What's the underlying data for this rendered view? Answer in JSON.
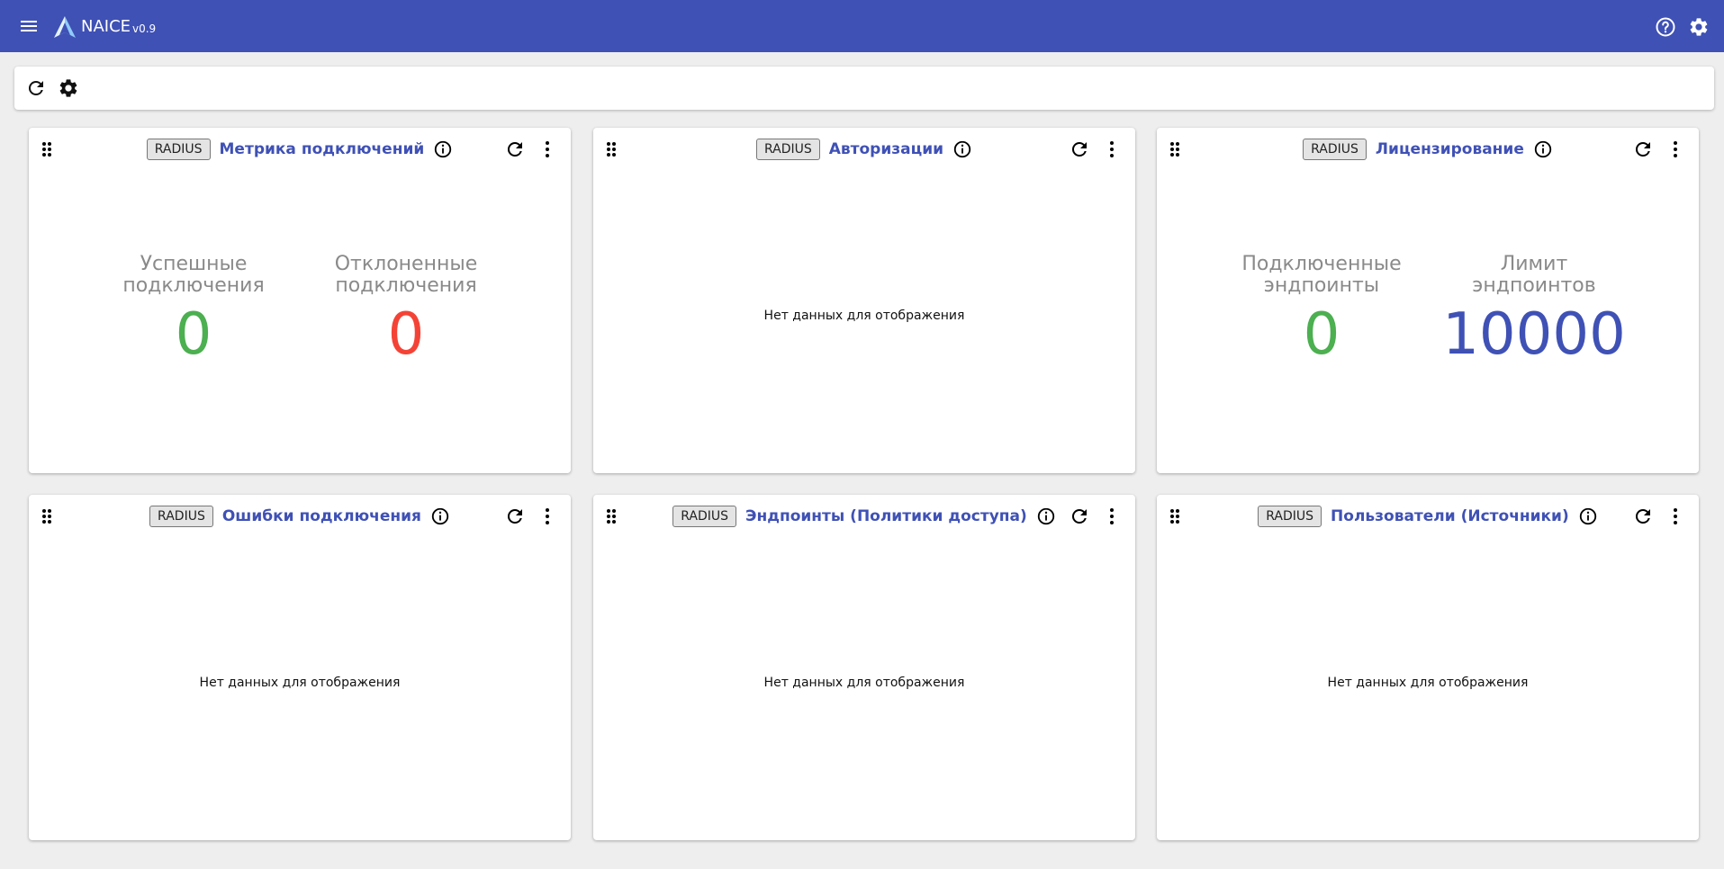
{
  "app": {
    "name": "NAICE",
    "version": "v0.9"
  },
  "icons": {
    "menu": "menu-icon",
    "logo": "naice-logo",
    "help": "help-circle-icon",
    "settings": "gear-icon",
    "refresh": "refresh-icon",
    "drag": "drag-handle-icon",
    "info": "info-icon",
    "more": "more-vertical-icon"
  },
  "colors": {
    "primary": "#3f51b5",
    "success": "#4caf50",
    "danger": "#f44336",
    "muted": "#8a8a8a",
    "background": "#eeeeee"
  },
  "widgets": [
    {
      "badge": "RADIUS",
      "title": "Метрика подключений",
      "metrics": [
        {
          "label_line1": "Успешные",
          "label_line2": "подключения",
          "value": "0"
        },
        {
          "label_line1": "Отклоненные",
          "label_line2": "подключения",
          "value": "0"
        }
      ]
    },
    {
      "badge": "RADIUS",
      "title": "Авторизации",
      "empty_text": "Нет данных для отображения"
    },
    {
      "badge": "RADIUS",
      "title": "Лицензирование",
      "metrics": [
        {
          "label_line1": "Подключенные",
          "label_line2": "эндпоинты",
          "value": "0"
        },
        {
          "label_line1": "Лимит",
          "label_line2": "эндпоинтов",
          "value": "10000"
        }
      ]
    },
    {
      "badge": "RADIUS",
      "title": "Ошибки подключения",
      "empty_text": "Нет данных для отображения"
    },
    {
      "badge": "RADIUS",
      "title": "Эндпоинты (Политики доступа)",
      "empty_text": "Нет данных для отображения"
    },
    {
      "badge": "RADIUS",
      "title": "Пользователи (Источники)",
      "empty_text": "Нет данных для отображения"
    }
  ]
}
